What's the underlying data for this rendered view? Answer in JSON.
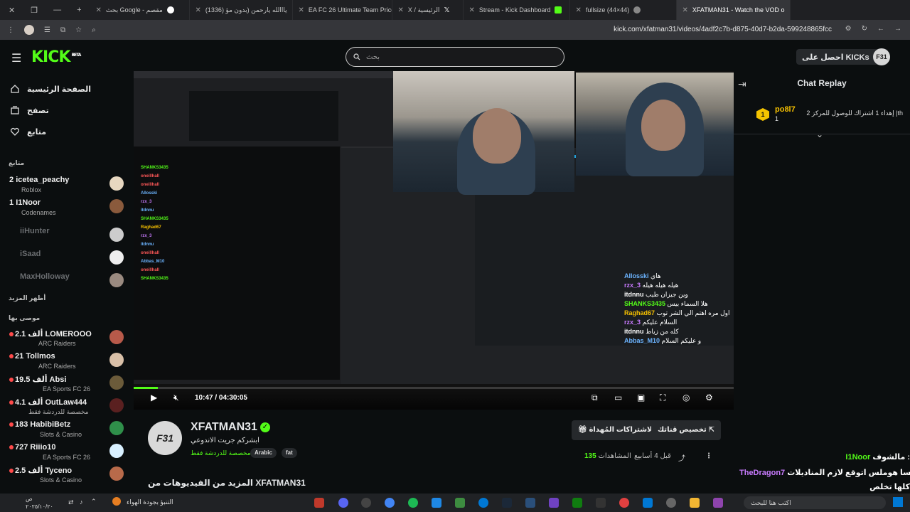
{
  "browser": {
    "tabs": [
      {
        "title": "بحث Google - مقصم",
        "fav": "#ffffff"
      },
      {
        "title": "(1336) يااالله يارحمن (بدون مؤ",
        "fav": "#ff0000"
      },
      {
        "title": "EA FC 26 Ultimate Team Prices",
        "fav": "#21c96a"
      },
      {
        "title": "X / الرئيسية",
        "fav": "#ffffff"
      },
      {
        "title": "Stream - Kick Dashboard",
        "fav": "#53fc18"
      },
      {
        "title": "fullsize (44×44)",
        "fav": "#888888"
      },
      {
        "title": "XFATMAN31 - Watch the VOD o",
        "fav": "#53fc18"
      }
    ],
    "url": "kick.com/xfatman31/videos/4adf2c7b-d875-40d7-b2da-599248865fcc"
  },
  "header": {
    "logo": "KICK",
    "logo_badge": "BETA",
    "search_placeholder": "بحث",
    "get_kicks": "احصل على KICKs",
    "avatar": "F31"
  },
  "sidebar": {
    "nav": [
      {
        "label": "الصفحة الرئيسية",
        "icon": "home-icon"
      },
      {
        "label": "تصفح",
        "icon": "browse-icon"
      },
      {
        "label": "متابع",
        "icon": "heart-icon"
      }
    ],
    "following_title": "متابع",
    "following": [
      {
        "count": "2",
        "name": "icetea_peachy",
        "game": "Roblox",
        "live": true,
        "color": "#e7d7c0"
      },
      {
        "count": "1",
        "name": "I1Noor",
        "game": "Codenames",
        "live": true,
        "color": "#8a5a3c"
      },
      {
        "count": "",
        "name": "iiHunter",
        "game": "",
        "live": false,
        "color": "#cccccc"
      },
      {
        "count": "",
        "name": "iSaad",
        "game": "",
        "live": false,
        "color": "#eeeeee"
      },
      {
        "count": "",
        "name": "MaxHolloway",
        "game": "",
        "live": false,
        "color": "#9a8a80"
      }
    ],
    "show_more": "أظهر المزيد",
    "recommended_title": "موصى بها",
    "recommended": [
      {
        "count": "2.1 ألف",
        "name": "LOMEROOO",
        "game": "ARC Raiders",
        "color": "#b85a4a"
      },
      {
        "count": "21",
        "name": "Tollmos",
        "game": "ARC Raiders",
        "color": "#d9c0a8"
      },
      {
        "count": "19.5 ألف",
        "name": "Absi",
        "game": "EA Sports FC 26",
        "color": "#6b5b3a"
      },
      {
        "count": "4.1 ألف",
        "name": "OutLaw444",
        "game": "مخصصة للدردشة فقط",
        "color": "#5a2020"
      },
      {
        "count": "183",
        "name": "HabibiBetz",
        "game": "Slots & Casino",
        "color": "#2f8f4a"
      },
      {
        "count": "727",
        "name": "Riiio10",
        "game": "EA Sports FC 26",
        "color": "#d8f0ff"
      },
      {
        "count": "2.5 ألف",
        "name": "Tyceno",
        "game": "Slots & Casino",
        "color": "#b86a4a"
      }
    ]
  },
  "player": {
    "current_time": "10:47",
    "duration": "04:30:05",
    "progress": 0.04,
    "overlay_chat": [
      {
        "name": "Allosski",
        "text": "هاي",
        "color": "#6cb4ff"
      },
      {
        "name": "rzx_3",
        "text": "هيله هيله هيله",
        "color": "#c97bff"
      },
      {
        "name": "itdnnu",
        "text": "وين جيزان طيب",
        "color": "#ffffff"
      },
      {
        "name": "SHANKS3435",
        "text": "هلا السماء بيس",
        "color": "#53fc18"
      },
      {
        "name": "Raghad67",
        "text": "اول مره اهتم الي الشر توب",
        "color": "#f6c000"
      },
      {
        "name": "rzx_3",
        "text": "السلام عليكم",
        "color": "#c97bff"
      },
      {
        "name": "itdnnu",
        "text": "كله من زياط",
        "color": "#ffffff"
      },
      {
        "name": "Abbas_M10",
        "text": "و عليكم السلام",
        "color": "#6cb4ff"
      }
    ]
  },
  "chat_replay": {
    "title": "Chat Replay",
    "pinned": {
      "badge": "1",
      "name": "po8l7",
      "count": "1",
      "text": "إهداء 1 اشتراك للوصول للمركز 2 |th"
    },
    "messages": [
      {
        "user": "I1Noor",
        "text": "مالشوف :",
        "color": "#53fc18"
      },
      {
        "user": "TheDragon7",
        "text": "ولسا هوملس اتوقع لازم المناديلات :",
        "color": "#c97bff"
      },
      {
        "user": "",
        "text": "كلها تخلص",
        "color": "#ffffff"
      },
      {
        "user": "TheDragon7",
        "text": "",
        "color": "#c97bff"
      }
    ]
  },
  "channel": {
    "avatar": "F31",
    "name": "XFATMAN31",
    "title": "ابشركم جريت الاندوعي",
    "category": "مخصصة للدردشة فقط",
    "tags": [
      "Arabic",
      "fat"
    ],
    "customize_channel": "تخصيص قناتك",
    "gift_subs": "الاشتراكات المُهداة",
    "views_label": "المشاهدات",
    "views": "135",
    "time_ago": "قبل 4 أسابيع",
    "more_vods": "المزيد من الفيديوهات من XFATMAN31"
  },
  "taskbar": {
    "clock_time": "ص",
    "clock_date": "٢٠٢٥/١٠/٢٠",
    "weather": "التنبؤ بجودة الهواء",
    "search": "اكتب هنا للبحث"
  },
  "colors": {
    "accent": "#53fc18",
    "bg": "#0b0e0f",
    "panel": "#26292c"
  }
}
